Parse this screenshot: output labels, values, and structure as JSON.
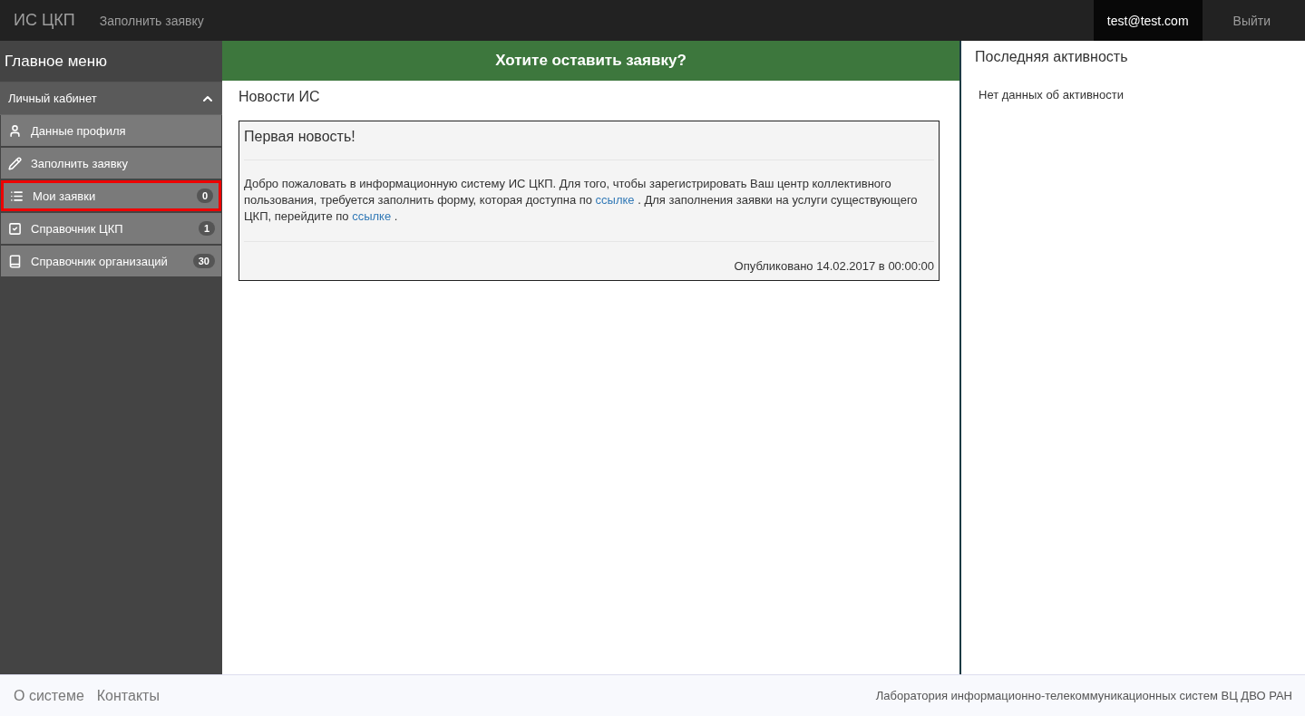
{
  "navbar": {
    "brand": "ИС ЦКП",
    "links": [
      "Заполнить заявку"
    ],
    "user": "test@test.com",
    "logout": "Выйти"
  },
  "sidebar": {
    "title": "Главное меню",
    "section": {
      "label": "Личный кабинет",
      "expanded": true
    },
    "items": [
      {
        "label": "Данные профиля",
        "selected": false
      },
      {
        "label": "Заполнить заявку",
        "selected": false
      },
      {
        "label": "Мои заявки",
        "badge": "0",
        "selected": true
      },
      {
        "label": "Справочник ЦКП",
        "badge": "1",
        "selected": false
      },
      {
        "label": "Справочник организаций",
        "badge": "30",
        "selected": false
      }
    ]
  },
  "banner": "Хотите оставить заявку?",
  "news": {
    "title": "Новости ИС",
    "items": [
      {
        "title": "Первая новость!",
        "body": [
          {
            "kind": "text",
            "text": "Добро пожаловать в информационную систему ИС ЦКП. Для того, чтобы зарегистрировать Ваш центр коллективного пользования, требуется заполнить форму, которая доступна по "
          },
          {
            "kind": "link",
            "text": "ссылке"
          },
          {
            "kind": "text",
            "text": " . Для заполнения заявки на услуги существующего ЦКП, перейдите по "
          },
          {
            "kind": "link",
            "text": "ссылке"
          },
          {
            "kind": "text",
            "text": " ."
          }
        ],
        "published": "Опубликовано 14.02.2017 в 00:00:00"
      }
    ]
  },
  "activity": {
    "title": "Последняя активность",
    "empty": "Нет данных об активности"
  },
  "footer": {
    "links": [
      "О системе",
      "Контакты"
    ],
    "credit": "Лаборатория информационно-телекоммуникационных систем ВЦ ДВО РАН"
  }
}
